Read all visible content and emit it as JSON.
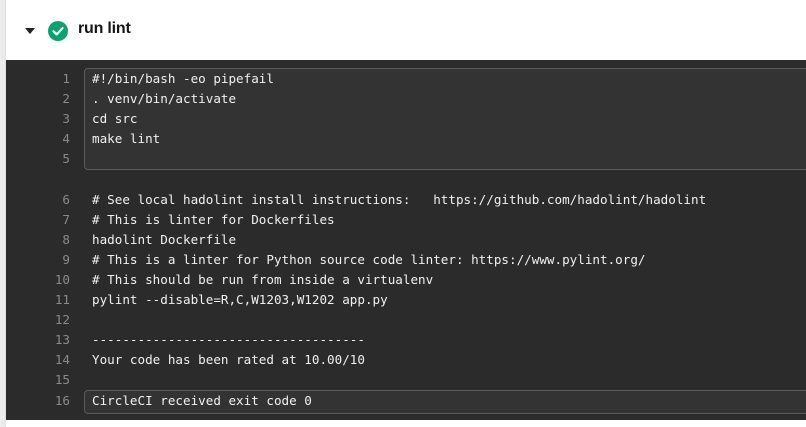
{
  "step": {
    "title": "run lint",
    "status": "success",
    "status_color": "#0aa36d",
    "collapse_icon": "caret-down-icon",
    "status_icon": "check-circle-icon"
  },
  "console": {
    "lines": [
      {
        "n": "1",
        "text": "#!/bin/bash -eo pipefail"
      },
      {
        "n": "2",
        "text": ". venv/bin/activate"
      },
      {
        "n": "3",
        "text": "cd src"
      },
      {
        "n": "4",
        "text": "make lint"
      },
      {
        "n": "5",
        "text": ""
      },
      {
        "n": "6",
        "text": "# See local hadolint install instructions:   https://github.com/hadolint/hadolint"
      },
      {
        "n": "7",
        "text": "# This is linter for Dockerfiles"
      },
      {
        "n": "8",
        "text": "hadolint Dockerfile"
      },
      {
        "n": "9",
        "text": "# This is a linter for Python source code linter: https://www.pylint.org/"
      },
      {
        "n": "10",
        "text": "# This should be run from inside a virtualenv"
      },
      {
        "n": "11",
        "text": "pylint --disable=R,C,W1203,W1202 app.py"
      },
      {
        "n": "12",
        "text": ""
      },
      {
        "n": "13",
        "text": "------------------------------------"
      },
      {
        "n": "14",
        "text": "Your code has been rated at 10.00/10"
      },
      {
        "n": "15",
        "text": ""
      },
      {
        "n": "16",
        "text": "CircleCI received exit code 0"
      }
    ]
  }
}
